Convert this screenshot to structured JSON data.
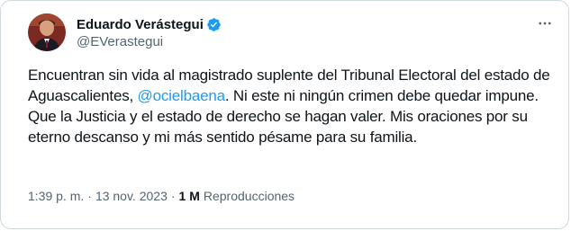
{
  "author": {
    "display_name": "Eduardo Verástegui",
    "handle": "@EVerastegui",
    "verified_color": "#1d9bf0",
    "avatar_icon": "profile-photo"
  },
  "more_icon": "more-horizontal-icon",
  "tweet": {
    "text_before_mention": "Encuentran sin vida al magistrado suplente del Tribunal Electoral del estado de Aguascalientes, ",
    "mention": "@ocielbaena",
    "text_after_mention": ". Ni este ni ningún crimen debe quedar impune. Que la Justicia y el estado de derecho se hagan valer. Mis oraciones por su eterno descanso y mi más sentido pésame para su familia."
  },
  "meta": {
    "time": "1:39 p. m.",
    "separator_1": "·",
    "date": "13 nov. 2023",
    "separator_2": "·",
    "views_count": "1 M",
    "views_label": "Reproducciones"
  },
  "colors": {
    "link": "#1d9bf0",
    "text": "#0f1419",
    "secondary": "#536471",
    "border": "#cfd9de"
  }
}
